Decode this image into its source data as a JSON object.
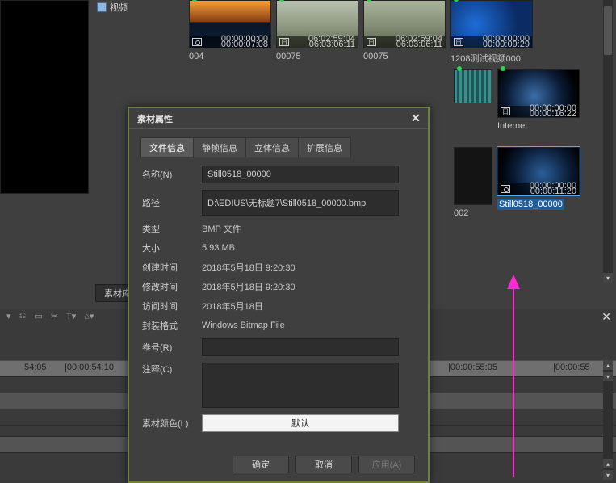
{
  "tree": {
    "item1": "视频"
  },
  "lib_tab": "素材库",
  "clips": [
    {
      "label": "004",
      "day": "cam",
      "tc1": "00:00:00:00",
      "tc2": "00:00:07:08"
    },
    {
      "label": "00075",
      "day": "日",
      "tc1": "06:02:59:04",
      "tc2": "06:03:06:11"
    },
    {
      "label": "00075",
      "day": "日",
      "tc1": "06:02:59:04",
      "tc2": "06:03:06:11"
    },
    {
      "label": "1208测试视频000",
      "day": "日",
      "tc1": "00:00:00:00",
      "tc2": "00:00:09:29"
    },
    {
      "label": "",
      "day": "",
      "tc1": "",
      "tc2": ""
    },
    {
      "label": "Internet",
      "day": "日",
      "tc1": "00:00:00:00",
      "tc2": "00:00:16:22"
    },
    {
      "label": "",
      "day": "",
      "tc1": "",
      "tc2": ""
    },
    {
      "label": "002",
      "day": "",
      "tc1": "",
      "tc2": ""
    },
    {
      "label": "Still0518_00000",
      "day": "cam",
      "tc1": "00:00:00:00",
      "tc2": "00:00:11:20"
    }
  ],
  "dialog": {
    "title": "素材属性",
    "tabs": {
      "file": "文件信息",
      "still": "静帧信息",
      "stereo": "立体信息",
      "ext": "扩展信息"
    },
    "labels": {
      "name": "名称(N)",
      "path": "路径",
      "type": "类型",
      "size": "大小",
      "created": "创建时间",
      "modified": "修改时间",
      "accessed": "访问时间",
      "container": "封装格式",
      "reel": "卷号(R)",
      "comment": "注释(C)",
      "color": "素材颜色(L)"
    },
    "values": {
      "name": "Still0518_00000",
      "path": "D:\\EDIUS\\无标题7\\Still0518_00000.bmp",
      "type": "BMP 文件",
      "size": "5.93 MB",
      "created": "2018年5月18日 9:20:30",
      "modified": "2018年5月18日 9:20:30",
      "accessed": "2018年5月18日",
      "container": "Windows Bitmap File",
      "color_btn": "默认"
    },
    "buttons": {
      "ok": "确定",
      "cancel": "取消",
      "apply": "应用(A)"
    }
  },
  "ruler": {
    "t0": "54:05",
    "t1": "|00:00:54:10",
    "t2": "|00:00:55:05",
    "t3": "|00:00:55"
  },
  "toolbar_glyphs": {
    "a": "▾",
    "b": "⎌",
    "c": "▭",
    "d": "✂",
    "e": "T▾",
    "f": "⌂▾"
  }
}
